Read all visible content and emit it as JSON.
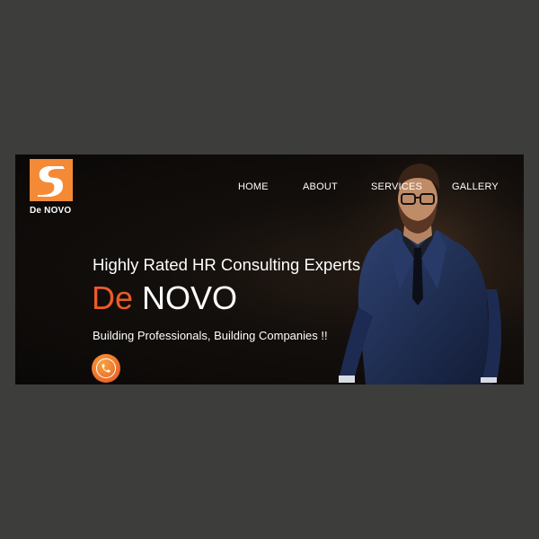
{
  "logo": {
    "name": "De NOVO",
    "accent": "#f58a36"
  },
  "nav": {
    "items": [
      {
        "label": "HOME"
      },
      {
        "label": "ABOUT"
      },
      {
        "label": "SERVICES"
      },
      {
        "label": "GALLERY"
      }
    ]
  },
  "hero": {
    "tagline": "Highly Rated HR Consulting Experts",
    "brand_first": "De",
    "brand_second": "NOVO",
    "subtitle": "Building Professionals, Building Companies !!",
    "brand_color": "#ee5a28",
    "call_icon": "phone-icon"
  },
  "colors": {
    "page_background": "#3d3d3b",
    "banner_background": "#0a0807",
    "text": "#ffffff"
  }
}
